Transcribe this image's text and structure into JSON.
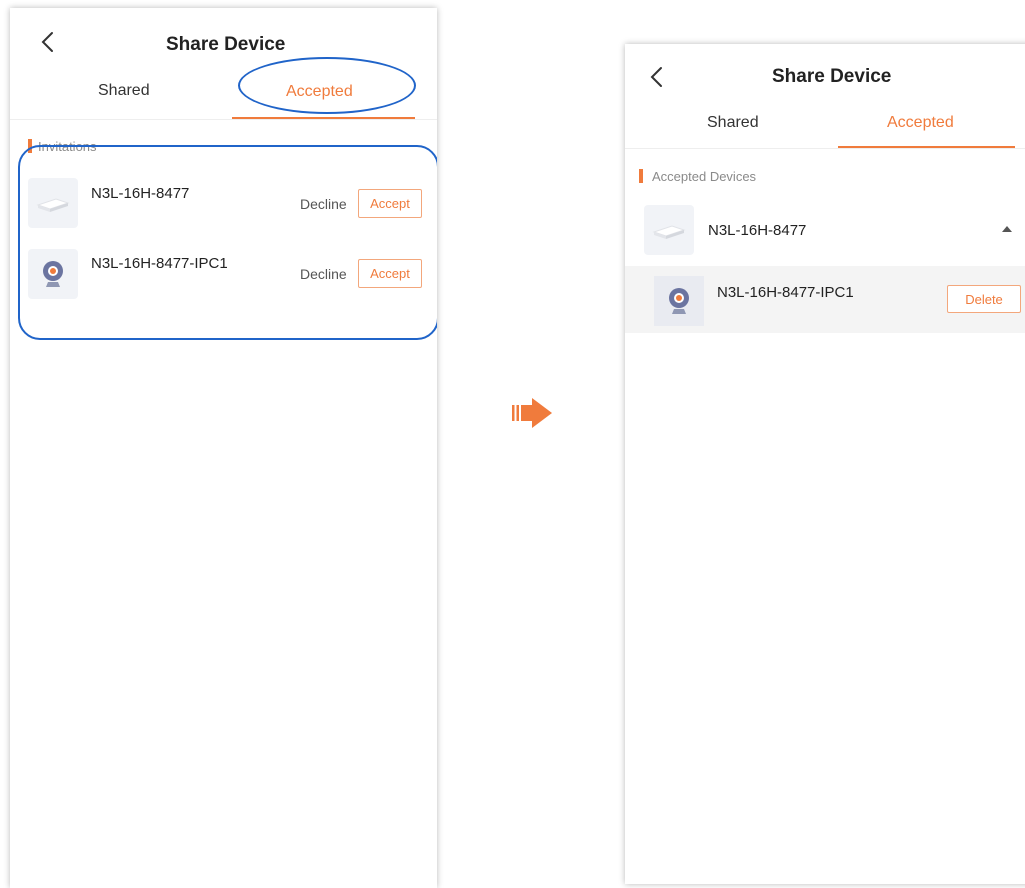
{
  "left_screen": {
    "header": {
      "title": "Share Device"
    },
    "tabs": [
      {
        "label": "Shared",
        "active": false
      },
      {
        "label": "Accepted",
        "active": true
      }
    ],
    "section": {
      "label": "Invitations"
    },
    "invitations": [
      {
        "name": "N3L-16H-8477",
        "icon": "router-device-icon",
        "decline_label": "Decline",
        "accept_label": "Accept"
      },
      {
        "name": "N3L-16H-8477-IPC1",
        "icon": "camera-device-icon",
        "decline_label": "Decline",
        "accept_label": "Accept"
      }
    ]
  },
  "right_screen": {
    "header": {
      "title": "Share Device"
    },
    "tabs": [
      {
        "label": "Shared",
        "active": false
      },
      {
        "label": "Accepted",
        "active": true
      }
    ],
    "section": {
      "label": "Accepted Devices"
    },
    "group": {
      "name": "N3L-16H-8477",
      "icon": "router-device-icon",
      "expanded": true,
      "children": [
        {
          "name": "N3L-16H-8477-IPC1",
          "icon": "camera-device-icon",
          "delete_label": "Delete"
        }
      ]
    }
  },
  "annotations": {
    "transition_arrow": "arrow-right-icon",
    "highlight_color": "#2064c9"
  },
  "colors": {
    "accent": "#f07b3c",
    "highlight": "#2064c9",
    "text": "#222222",
    "muted": "#8a8a8a"
  }
}
